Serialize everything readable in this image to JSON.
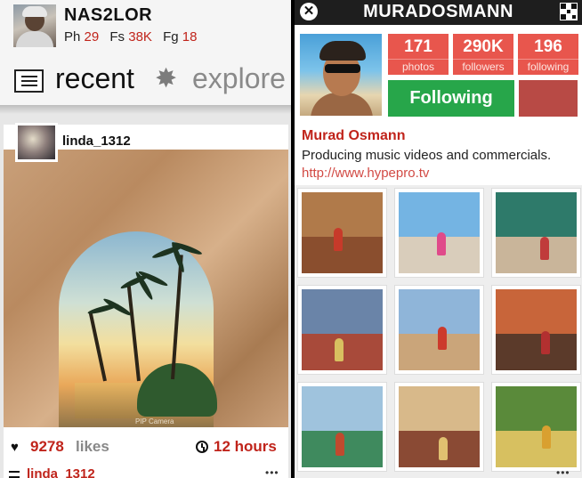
{
  "left": {
    "header": {
      "username": "NAS2LOR",
      "stats": [
        {
          "key": "Ph",
          "value": "29"
        },
        {
          "key": "Fs",
          "value": "38K"
        },
        {
          "key": "Fg",
          "value": "18"
        }
      ]
    },
    "nav": {
      "recent_label": "recent",
      "explore_label": "explore",
      "recent_icon": "newspaper-icon",
      "explore_icon": "burst-icon"
    },
    "post": {
      "username": "linda_1312",
      "watermark": "PIP Camera",
      "likes_count": "9278",
      "likes_label": "likes",
      "time_label": "12 hours",
      "next_username": "linda_1312"
    },
    "more_label": "•••"
  },
  "right": {
    "title": "MURADOSMANN",
    "stats": [
      {
        "value": "171",
        "label": "photos"
      },
      {
        "value": "290K",
        "label": "followers"
      },
      {
        "value": "196",
        "label": "following"
      }
    ],
    "follow_button": "Following",
    "full_name": "Murad Osmann",
    "bio": "Producing music videos and commercials.",
    "link": "http://www.hypepro.tv",
    "grid_tiles": [
      {
        "top": "#b07a4a",
        "bottom": "#8a4e2e",
        "fig": "#c73a2a"
      },
      {
        "top": "#74b4e3",
        "bottom": "#d9cdbb",
        "fig": "#e04a8a"
      },
      {
        "top": "#2e7a6a",
        "bottom": "#c9b59a",
        "fig": "#c03b3b"
      },
      {
        "top": "#6a84a8",
        "bottom": "#a84a3a",
        "fig": "#d8c060"
      },
      {
        "top": "#8fb5d9",
        "bottom": "#caa57a",
        "fig": "#cc3a2c"
      },
      {
        "top": "#c8653a",
        "bottom": "#5b3a2a",
        "fig": "#b23030"
      },
      {
        "top": "#9fc3dd",
        "bottom": "#3f8a5e",
        "fig": "#c04a2e"
      },
      {
        "top": "#d8b98a",
        "bottom": "#8a4a34",
        "fig": "#e0c070"
      },
      {
        "top": "#5a8a3a",
        "bottom": "#d7c060",
        "fig": "#d9a030"
      }
    ],
    "more_label": "•••"
  }
}
